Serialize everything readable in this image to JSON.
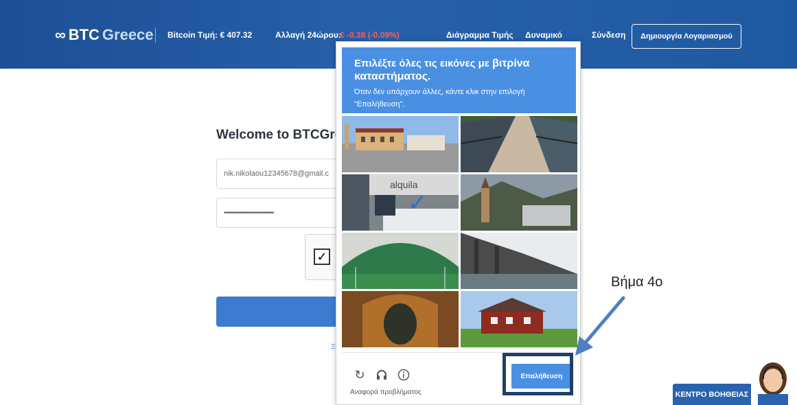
{
  "header": {
    "logo_btc": "BTC",
    "logo_greece": "Greece",
    "price_label": "Bitcoin Τιμή: € 407.32",
    "change_label": "Αλλαγή 24ώρου:",
    "change_value": "€ -0.38 (-0.09%)",
    "nav_chart": "Διάγραμμα Τιμής",
    "nav_dynamic": "Δυναμικό",
    "nav_login": "Σύνδεση",
    "signup": "Δημιουργία Λογαριασμού"
  },
  "login": {
    "welcome": "Welcome to BTCGre",
    "email": "nik.nikolaou12345678@gmail.c",
    "password": "•••••••••••••••••••••••••••••",
    "link": "Ξ"
  },
  "recaptcha": {
    "title_pre": "Επιλέξτε όλες τις εικόνες με ",
    "title_bold": "βιτρίνα καταστήματος",
    "title_post": ".",
    "subtitle": "Όταν δεν υπάρχουν άλλες, κάντε κλικ στην επιλογή \"Επαλήθευση\".",
    "verify": "Επαλήθευση",
    "report": "Αναφορά προβλήματος",
    "tile_store_sign": "alquila",
    "colors": {
      "primary": "#4a90e2",
      "check": "#2f6fd1"
    }
  },
  "annotation": {
    "step": "Βήμα 4ο",
    "color": "#4f7fc1"
  },
  "help": {
    "label": "ΚΕΝΤΡΟ ΒΟΗΘΕΙΑΣ"
  }
}
